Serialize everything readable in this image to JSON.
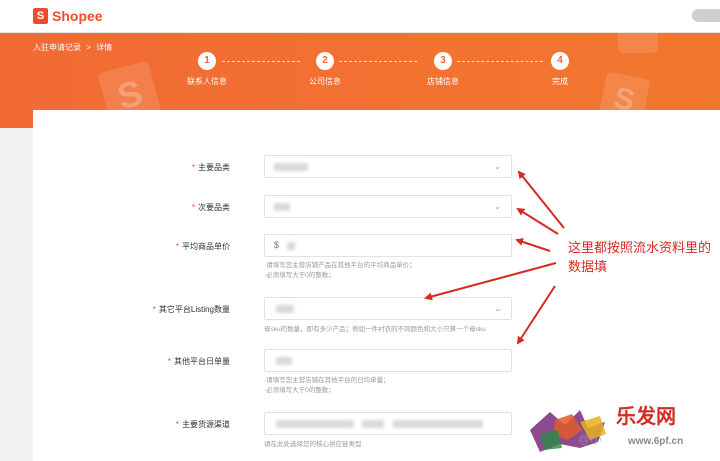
{
  "header": {
    "brand": "Shopee",
    "brand_glyph": "S"
  },
  "hero": {
    "breadcrumb": [
      "入驻申请记录",
      ">",
      "详情"
    ],
    "steps": [
      {
        "num": "1",
        "label": "联系人信息"
      },
      {
        "num": "2",
        "label": "公司信息"
      },
      {
        "num": "3",
        "label": "店铺信息"
      },
      {
        "num": "4",
        "label": "完成"
      }
    ]
  },
  "form": {
    "required_mark": "*",
    "primary_category": {
      "label": "主要品类"
    },
    "secondary_category": {
      "label": "次要品类"
    },
    "avg_price": {
      "label": "平均商品单价",
      "prefix": "$",
      "hints": [
        "·请填写您主营店铺产品在其他平台的平均商品单价；",
        "·必须填写大于0的整数；"
      ]
    },
    "listing_count": {
      "label": "其它平台Listing数量",
      "hint": "母sku的数量，即有多少产品；例如一件衬衣的不同颜色和大小只算一个母sku"
    },
    "daily_orders": {
      "label": "其他平台日单量",
      "hints": [
        "·请填写您主营店铺在其他平台的日均单量；",
        "·必须填写大于0的整数；"
      ]
    },
    "supply_channel": {
      "label": "主要货源渠道",
      "hint": "请在此处选择您的核心供应链类型"
    },
    "chevron": "⌄"
  },
  "annotation": {
    "lines": [
      "这里都按照流水资料里的",
      "数据填"
    ]
  },
  "watermark": {
    "text": "乐发网",
    "url": "www.6pf.cn",
    "ghost": "@小"
  },
  "colors": {
    "brand": "#ee4d2d",
    "hero": "#f26a34",
    "annotation": "#d42b22"
  }
}
